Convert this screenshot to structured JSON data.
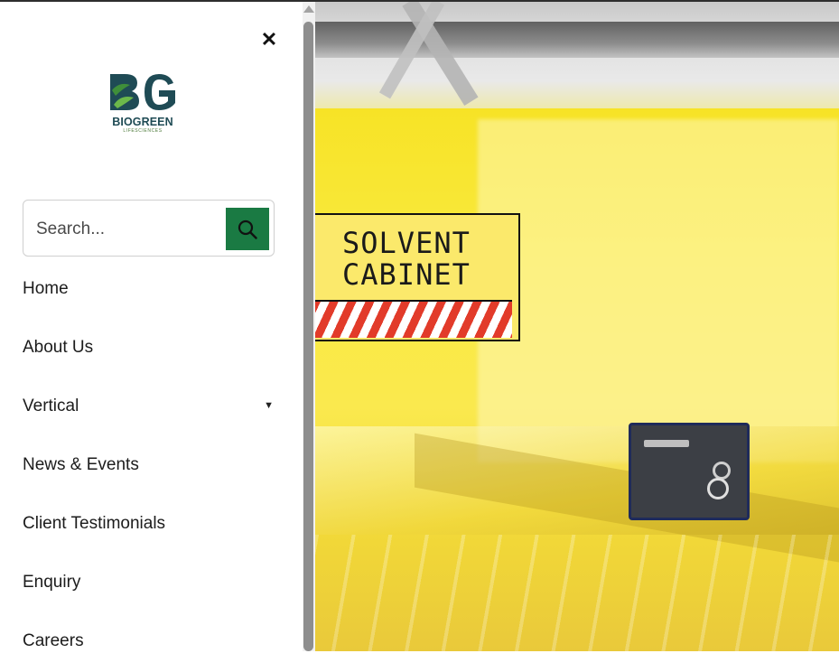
{
  "drawer": {
    "close_symbol": "✕",
    "logo": {
      "monogram": "BG",
      "brand": "BIOGREEN",
      "tagline": "LIFESCIENCES"
    },
    "search": {
      "placeholder": "Search...",
      "button_icon": "search-icon"
    },
    "menu": [
      {
        "label": "Home"
      },
      {
        "label": "About Us"
      },
      {
        "label": "Vertical",
        "has_dropdown": true,
        "caret": "▼"
      },
      {
        "label": "News & Events"
      },
      {
        "label": "Client Testimonials"
      },
      {
        "label": "Enquiry"
      },
      {
        "label": "Careers"
      }
    ]
  },
  "background_photo": {
    "sign": {
      "line1": "SOLVENT",
      "line2": "CABINET"
    }
  },
  "colors": {
    "search_button": "#1a7a43",
    "logo_teal": "#1f4b55",
    "logo_green": "#3f8f3a",
    "wall_yellow": "#f7e326"
  }
}
